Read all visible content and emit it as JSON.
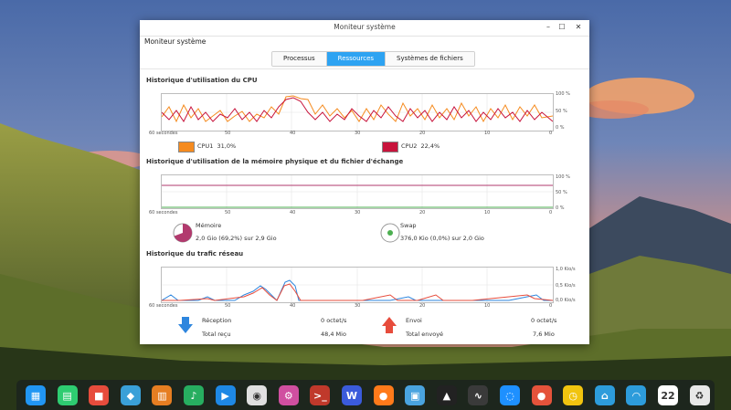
{
  "window": {
    "title": "Moniteur système",
    "app_title": "Moniteur système",
    "controls": {
      "minimize": "–",
      "maximize": "☐",
      "close": "✕"
    }
  },
  "tabs": [
    {
      "label": "Processus",
      "active": false
    },
    {
      "label": "Ressources",
      "active": true
    },
    {
      "label": "Systèmes de fichiers",
      "active": false
    }
  ],
  "cpu": {
    "title": "Historique d'utilisation du CPU",
    "x_ticks": [
      "60 secondes",
      "50",
      "40",
      "30",
      "20",
      "10",
      "0"
    ],
    "y_ticks": [
      "100 %",
      "50 %",
      "0 %"
    ],
    "cpu1": {
      "label": "CPU1",
      "value": "31,0%",
      "color": "#f58b1f"
    },
    "cpu2": {
      "label": "CPU2",
      "value": "22,4%",
      "color": "#c8143c"
    }
  },
  "memory": {
    "title": "Historique d'utilisation de la mémoire physique et du fichier d'échange",
    "x_ticks": [
      "60 secondes",
      "50",
      "40",
      "30",
      "20",
      "10",
      "0"
    ],
    "y_ticks": [
      "100 %",
      "50 %",
      "0 %"
    ],
    "mem": {
      "label": "Mémoire",
      "detail": "2,0 Gio (69,2%) sur 2,9 Gio",
      "color": "#b23a6e",
      "fraction": 0.692
    },
    "swap": {
      "label": "Swap",
      "detail": "376,0 Kio (0,0%) sur 2,0 Gio",
      "color": "#4caf50",
      "fraction": 0.0
    }
  },
  "network": {
    "title": "Historique du trafic réseau",
    "x_ticks": [
      "60 secondes",
      "50",
      "40",
      "30",
      "20",
      "10",
      "0"
    ],
    "y_ticks": [
      "1,0 Kio/s",
      "0,5 Kio/s",
      "0,0 Kio/s"
    ],
    "receive": {
      "label": "Réception",
      "rate": "0 octet/s",
      "total_label": "Total reçu",
      "total": "48,4 Mio",
      "color": "#2e86de"
    },
    "send": {
      "label": "Envoi",
      "rate": "0 octet/s",
      "total_label": "Total envoyé",
      "total": "7,6 Mio",
      "color": "#e74c3c"
    }
  },
  "dock": {
    "icons": [
      {
        "name": "launcher-icon",
        "glyph": "▦",
        "color": "#2196f3"
      },
      {
        "name": "file-manager-icon",
        "glyph": "▤",
        "color": "#2ecc71"
      },
      {
        "name": "screen-recorder-icon",
        "glyph": "■",
        "color": "#e74c3c"
      },
      {
        "name": "app-store-icon",
        "glyph": "◆",
        "color": "#3aa0d8"
      },
      {
        "name": "archive-icon",
        "glyph": "▥",
        "color": "#e67e22"
      },
      {
        "name": "music-icon",
        "glyph": "♪",
        "color": "#27ae60"
      },
      {
        "name": "video-player-icon",
        "glyph": "▶",
        "color": "#1e88e5"
      },
      {
        "name": "chrome-icon",
        "glyph": "◉",
        "color": "#e0e0e0"
      },
      {
        "name": "settings-icon",
        "glyph": "⚙",
        "color": "#d04fa0"
      },
      {
        "name": "terminal-icon",
        "glyph": ">_",
        "color": "#c0392b"
      },
      {
        "name": "wps-writer-icon",
        "glyph": "W",
        "color": "#3b5bdb"
      },
      {
        "name": "firefox-icon",
        "glyph": "●",
        "color": "#ff7a1a"
      },
      {
        "name": "image-viewer-icon",
        "glyph": "▣",
        "color": "#4aa3df"
      },
      {
        "name": "inkscape-icon",
        "glyph": "▲",
        "color": "#222222"
      },
      {
        "name": "system-monitor-icon",
        "glyph": "∿",
        "color": "#3a3a3a"
      },
      {
        "name": "deepin-icon",
        "glyph": "◌",
        "color": "#1e90ff"
      },
      {
        "name": "recorder-icon",
        "glyph": "●",
        "color": "#e5533b"
      },
      {
        "name": "clock-icon",
        "glyph": "◷",
        "color": "#f1c40f"
      },
      {
        "name": "device-manager-icon",
        "glyph": "⌂",
        "color": "#2d9cdb"
      },
      {
        "name": "wifi-icon",
        "glyph": "◠",
        "color": "#2d9cdb"
      },
      {
        "name": "date-icon",
        "glyph": "22",
        "color": "#ffffff"
      },
      {
        "name": "trash-icon",
        "glyph": "♻",
        "color": "#e8e8e8"
      }
    ]
  }
}
